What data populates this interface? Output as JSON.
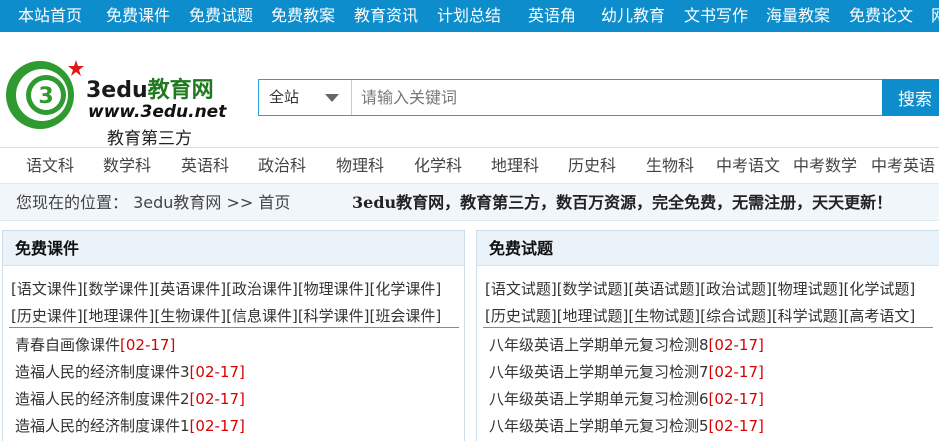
{
  "topnav": [
    "本站首页",
    "免费课件",
    "免费试题",
    "免费教案",
    "教育资讯",
    "计划总结",
    "英语角",
    "幼儿教育",
    "文书写作",
    "海量教案",
    "免费论文",
    "网"
  ],
  "logo": {
    "brand": "3edu",
    "brand_cn": "教育网",
    "url": "www.3edu.net",
    "tagline": "教育第三方"
  },
  "search": {
    "scope": "全站",
    "placeholder": "请输入关键词",
    "button": "搜索"
  },
  "subnav": [
    "语文科",
    "数学科",
    "英语科",
    "政治科",
    "物理科",
    "化学科",
    "地理科",
    "历史科",
    "生物科",
    "中考语文",
    "中考数学",
    "中考英语"
  ],
  "breadcrumb": {
    "text": "您现在的位置：  3edu教育网 >> 首页",
    "slogan": "3edu教育网，教育第三方，数百万资源，完全免费，无需注册，天天更新！"
  },
  "left_panel": {
    "title": "免费课件",
    "cat_row1": "[语文课件][数学课件][英语课件][政治课件][物理课件][化学课件]",
    "cat_row2": "[历史课件][地理课件][生物课件][信息课件][科学课件][班会课件]",
    "items": [
      {
        "title": "青春自画像课件",
        "date": "02-17"
      },
      {
        "title": "造福人民的经济制度课件3",
        "date": "02-17"
      },
      {
        "title": "造福人民的经济制度课件2",
        "date": "02-17"
      },
      {
        "title": "造福人民的经济制度课件1",
        "date": "02-17"
      }
    ]
  },
  "right_panel": {
    "title": "免费试题",
    "cat_row1": "[语文试题][数学试题][英语试题][政治试题][物理试题][化学试题]",
    "cat_row2": "[历史试题][地理试题][生物试题][综合试题][科学试题][高考语文]",
    "items": [
      {
        "title": "八年级英语上学期单元复习检测8",
        "date": "02-17"
      },
      {
        "title": "八年级英语上学期单元复习检测7",
        "date": "02-17"
      },
      {
        "title": "八年级英语上学期单元复习检测6",
        "date": "02-17"
      },
      {
        "title": "八年级英语上学期单元复习检测5",
        "date": "02-17"
      }
    ]
  },
  "colors": {
    "nav_blue": "#0e8dcc",
    "date_red": "#d80000",
    "logo_green": "#1f7a1f"
  }
}
